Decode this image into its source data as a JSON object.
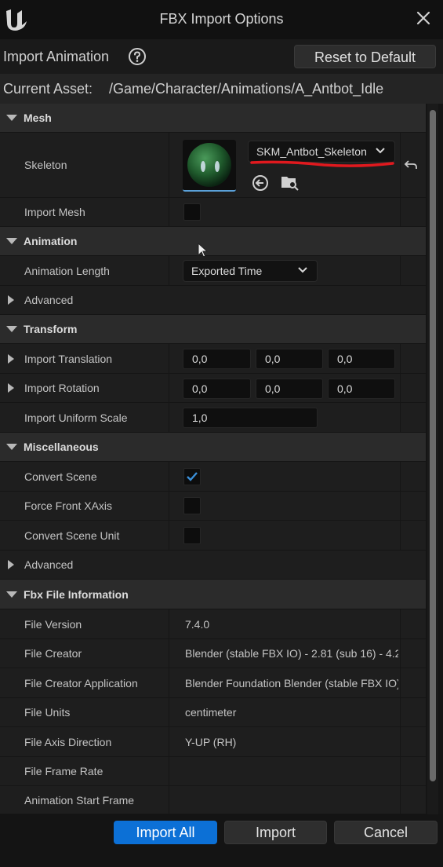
{
  "window": {
    "title": "FBX Import Options"
  },
  "toprow": {
    "import_animation_label": "Import Animation",
    "reset_label": "Reset to Default"
  },
  "asset": {
    "label": "Current Asset:",
    "value": "/Game/Character/Animations/A_Antbot_Idle"
  },
  "mesh": {
    "header": "Mesh",
    "skeleton_label": "Skeleton",
    "skeleton_value": "SKM_Antbot_Skeleton",
    "import_mesh_label": "Import Mesh",
    "import_mesh_checked": false
  },
  "animation": {
    "header": "Animation",
    "length_label": "Animation Length",
    "length_value": "Exported Time",
    "advanced_label": "Advanced"
  },
  "transform": {
    "header": "Transform",
    "translation_label": "Import Translation",
    "translation": [
      "0,0",
      "0,0",
      "0,0"
    ],
    "rotation_label": "Import Rotation",
    "rotation": [
      "0,0",
      "0,0",
      "0,0"
    ],
    "scale_label": "Import Uniform Scale",
    "scale": "1,0"
  },
  "misc": {
    "header": "Miscellaneous",
    "convert_scene_label": "Convert Scene",
    "convert_scene_checked": true,
    "force_front_label": "Force Front XAxis",
    "force_front_checked": false,
    "convert_unit_label": "Convert Scene Unit",
    "convert_unit_checked": false,
    "advanced_label": "Advanced"
  },
  "fbx_info": {
    "header": "Fbx File Information",
    "rows": [
      {
        "label": "File Version",
        "value": "7.4.0"
      },
      {
        "label": "File Creator",
        "value": "Blender (stable FBX IO) - 2.81 (sub 16) - 4.2"
      },
      {
        "label": "File Creator Application",
        "value": "Blender Foundation Blender (stable FBX IO)"
      },
      {
        "label": "File Units",
        "value": "centimeter"
      },
      {
        "label": "File Axis Direction",
        "value": "Y-UP (RH)"
      },
      {
        "label": "File Frame Rate",
        "value": ""
      },
      {
        "label": "Animation Start Frame",
        "value": ""
      }
    ]
  },
  "buttons": {
    "import_all": "Import All",
    "import": "Import",
    "cancel": "Cancel"
  },
  "icons": [
    "unreal-logo-icon",
    "close-icon",
    "help-icon",
    "use-selected-icon",
    "browse-icon",
    "reset-arrow-icon",
    "chevron-down-icon",
    "checkmark-icon"
  ],
  "colors": {
    "accent": "#0c70d6",
    "annotation": "#e0191e",
    "checkmark": "#3a8fd8"
  }
}
